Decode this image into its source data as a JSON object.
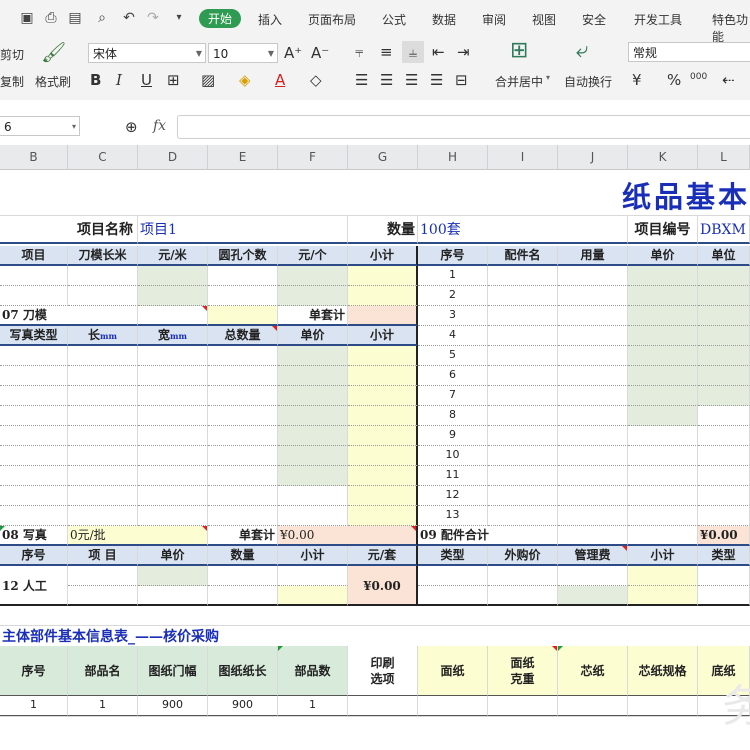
{
  "ribbon": {
    "tabs": [
      "开始",
      "插入",
      "页面布局",
      "公式",
      "数据",
      "审阅",
      "视图",
      "安全",
      "开发工具",
      "特色功能"
    ],
    "clipboard": {
      "cut": "剪切",
      "copy": "复制",
      "format_painter": "格式刷"
    },
    "font_name": "宋体",
    "font_size": "10",
    "merge_center": "合并居中",
    "wrap_text": "自动换行",
    "number_format": "常规",
    "percent_symbol": "%",
    "thousand_symbol": "000"
  },
  "formula_bar": {
    "name_box": "6",
    "fx_label": "fx",
    "formula": ""
  },
  "columns": [
    "B",
    "C",
    "D",
    "E",
    "F",
    "G",
    "H",
    "I",
    "J",
    "K",
    "L"
  ],
  "sheet": {
    "title": "纸品基本",
    "project_name_label": "项目名称",
    "project_name_value": "项目1",
    "quantity_label": "数量",
    "quantity_value": "100套",
    "project_code_label": "项目编号",
    "project_code_value": "DBXM",
    "die_header": [
      "项目",
      "刀模长米",
      "元/米",
      "圆孔个数",
      "元/个",
      "小计"
    ],
    "die_section": "07 刀模",
    "die_unit_total": "单套计",
    "photo_header": [
      "写真类型",
      "长",
      "宽",
      "总数量",
      "单价",
      "小计"
    ],
    "unit_mm": "mm",
    "parts_header": [
      "序号",
      "配件名",
      "用量",
      "单价",
      "单位"
    ],
    "parts_numbers": [
      "1",
      "2",
      "3",
      "4",
      "5",
      "6",
      "7",
      "8",
      "9",
      "10",
      "11",
      "12",
      "13"
    ],
    "photo_section": "08 写真",
    "photo_batch": "0元/批",
    "photo_unit_total": "单套计",
    "photo_unit_value": "¥0.00",
    "parts_section": "09 配件合计",
    "parts_total": "¥0.00",
    "labor_header": [
      "序号",
      "项 目",
      "单价",
      "数量",
      "小计",
      "元/套"
    ],
    "purchase_header": [
      "类型",
      "外购价",
      "管理费",
      "小计",
      "类型"
    ],
    "labor_section": "12 人工",
    "labor_total": "¥0.00",
    "table2_title": "主体部件基本信息表_——核价采购",
    "table2_header": [
      "序号",
      "部品名",
      "图纸门幅",
      "图纸纸长",
      "部品数",
      "印刷\n选项",
      "面纸",
      "面纸\n克重",
      "芯纸",
      "芯纸规格",
      "底纸"
    ],
    "table2_row1": [
      "1",
      "1",
      "900",
      "900",
      "1"
    ]
  }
}
